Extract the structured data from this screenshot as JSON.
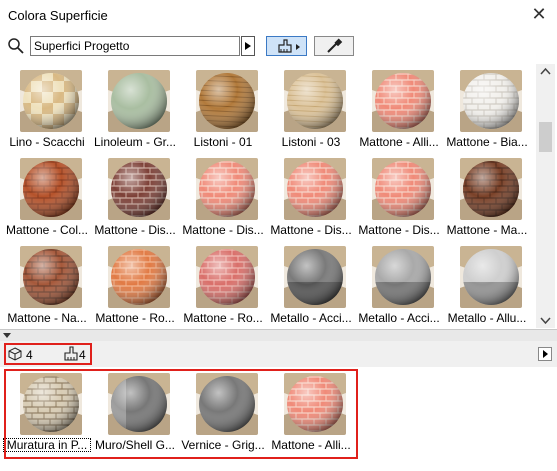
{
  "window": {
    "title": "Colora Superficie",
    "close_glyph": "✕"
  },
  "toolbar": {
    "search_value": "Superfici Progetto",
    "icons": [
      "search-icon",
      "brush-icon",
      "eyedropper-icon"
    ]
  },
  "materials": [
    {
      "label": "Lino - Scacchi",
      "kind": "checker"
    },
    {
      "label": "Linoleum - Gr...",
      "kind": "linoleum"
    },
    {
      "label": "Listoni - 01",
      "kind": "wood-dark"
    },
    {
      "label": "Listoni - 03",
      "kind": "wood-light"
    },
    {
      "label": "Mattone - Alli...",
      "kind": "brick-salmon"
    },
    {
      "label": "Mattone - Bia...",
      "kind": "brick-white"
    },
    {
      "label": "Mattone - Col...",
      "kind": "brick-rough"
    },
    {
      "label": "Mattone - Dis...",
      "kind": "brick-dark"
    },
    {
      "label": "Mattone - Dis...",
      "kind": "brick-salmon"
    },
    {
      "label": "Mattone - Dis...",
      "kind": "brick-salmon"
    },
    {
      "label": "Mattone - Dis...",
      "kind": "brick-salmon"
    },
    {
      "label": "Mattone - Ma...",
      "kind": "brick-brown"
    },
    {
      "label": "Mattone - Na...",
      "kind": "brick-mixed"
    },
    {
      "label": "Mattone - Ro...",
      "kind": "brick-orange"
    },
    {
      "label": "Mattone - Ro...",
      "kind": "brick-herring"
    },
    {
      "label": "Metallo - Acci...",
      "kind": "metal-dark"
    },
    {
      "label": "Metallo - Acci...",
      "kind": "metal"
    },
    {
      "label": "Metallo - Allu...",
      "kind": "metal-light"
    }
  ],
  "selection_bar": {
    "element_count": "4",
    "surface_count": "4"
  },
  "selected": [
    {
      "label": "Muratura in P...",
      "kind": "stone"
    },
    {
      "label": "Muro/Shell G...",
      "kind": "gray-shell"
    },
    {
      "label": "Vernice - Grig...",
      "kind": "gray"
    },
    {
      "label": "Mattone - Alli...",
      "kind": "brick-salmon"
    }
  ]
}
